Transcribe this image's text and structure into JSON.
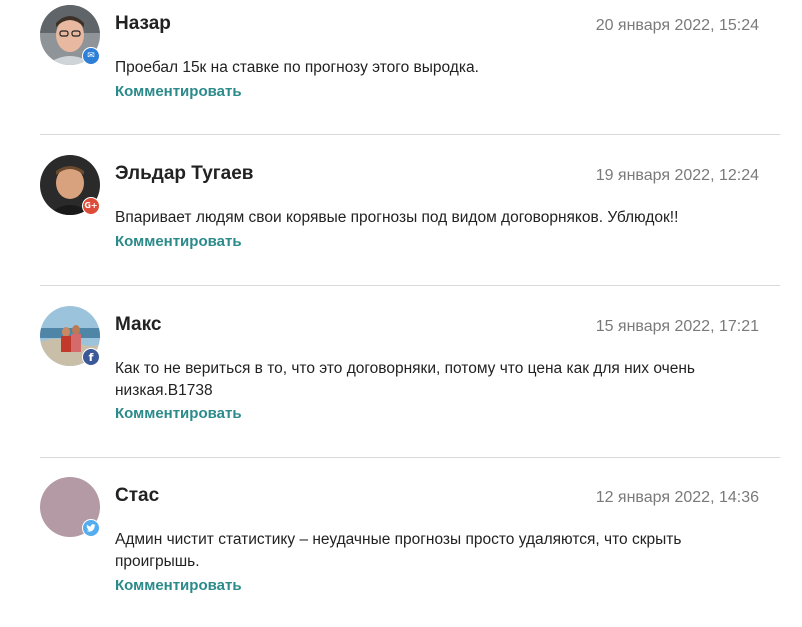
{
  "comments": [
    {
      "author": "Назар",
      "date": "20 января 2022, 15:24",
      "text": "Проебал 15к на ставке по прогнозу этого выродка.",
      "reply_label": "Комментировать",
      "badge": {
        "icon": "envelope-icon",
        "color": "#2f7fd6",
        "glyph": "✉"
      }
    },
    {
      "author": "Эльдар Тугаев",
      "date": "19 января 2022, 12:24",
      "text": "Впаривает людям свои корявые прогнозы под видом договорняков. Ублюдок!!",
      "reply_label": "Комментировать",
      "badge": {
        "icon": "google-plus-icon",
        "color": "#dd4b39",
        "glyph": "G+"
      }
    },
    {
      "author": "Макс",
      "date": "15 января 2022, 17:21",
      "text": "Как то не вериться в то, что это договорняки, потому что цена как для них очень низкая.В1738",
      "reply_label": "Комментировать",
      "badge": {
        "icon": "facebook-icon",
        "color": "#3b5998",
        "glyph": "f"
      }
    },
    {
      "author": "Стас",
      "date": "12 января 2022, 14:36",
      "text": "Админ чистит статистику – неудачные прогнозы просто удаляются, что скрыть проигрышь.",
      "reply_label": "Комментировать",
      "badge": {
        "icon": "twitter-icon",
        "color": "#55acee",
        "glyph": "🐦"
      }
    }
  ],
  "colors": {
    "reply_link": "#2b8a8a",
    "date_text": "#7a7a7a",
    "divider": "#d9d9d9",
    "placeholder_avatar": "#b49aa4"
  }
}
